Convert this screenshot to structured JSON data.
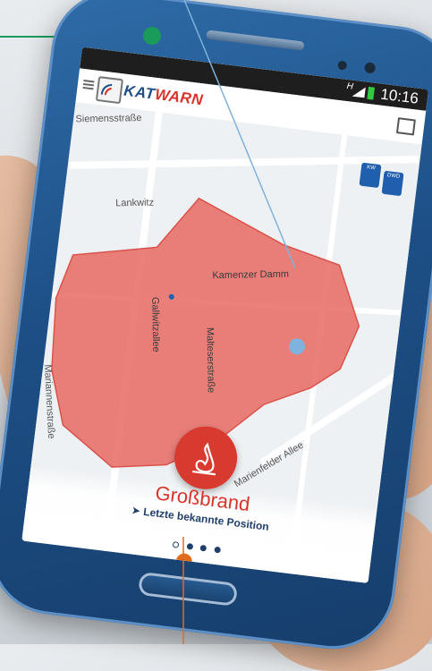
{
  "status_bar": {
    "network": "H",
    "time": "10:16"
  },
  "app_bar": {
    "brand_part1": "KAT",
    "brand_part2": "WARN"
  },
  "map": {
    "streets": [
      "Siemensstraße",
      "Lankwitz",
      "Kamenzer Damm",
      "Gallwitzallee",
      "Malteserstraße",
      "Mariannenstraße",
      "Marienfelder Allee"
    ],
    "badges": [
      {
        "label": "KW"
      },
      {
        "label": "DWD"
      }
    ],
    "area_color": "#e86a63"
  },
  "alert_card": {
    "title": "Großbrand",
    "subtitle": "Letzte bekannte Position",
    "page_count": 4,
    "current_page": 1
  },
  "colors": {
    "brand_blue": "#1f4f8a",
    "brand_red": "#d9342b",
    "callout_green": "#1a9a5b",
    "callout_blue": "#7fb2dc",
    "callout_orange": "#e26a1c"
  }
}
